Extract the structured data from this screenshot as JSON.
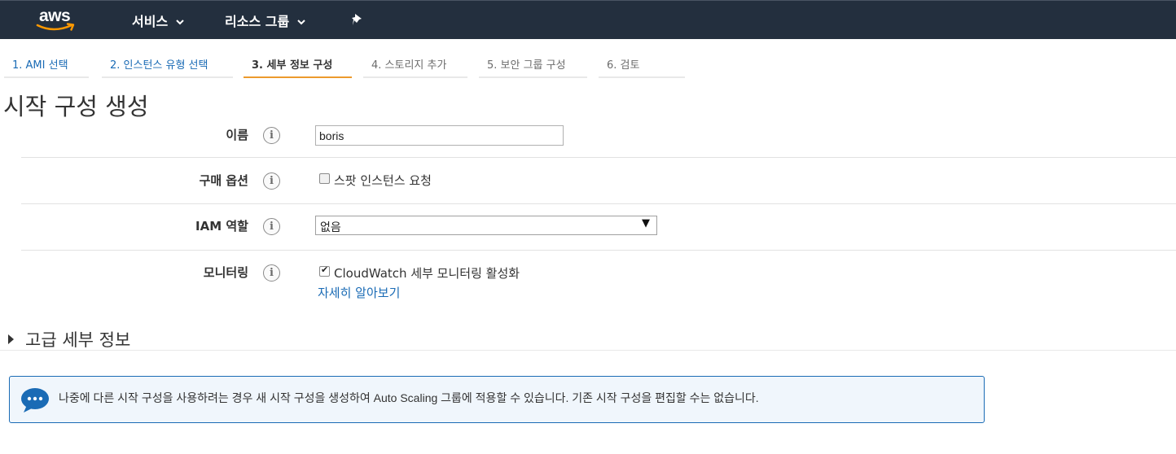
{
  "header": {
    "logo_text": "aws",
    "services_label": "서비스",
    "resource_groups_label": "리소스 그룹",
    "icons": {
      "services_chevron": "chevron-down-icon",
      "resource_groups_chevron": "chevron-down-icon",
      "pin": "pin-icon"
    }
  },
  "wizard": {
    "steps": [
      {
        "label": "1. AMI 선택",
        "state": "link"
      },
      {
        "label": "2. 인스턴스 유형 선택",
        "state": "link"
      },
      {
        "label": "3. 세부 정보 구성",
        "state": "active"
      },
      {
        "label": "4. 스토리지 추가",
        "state": "disabled"
      },
      {
        "label": "5. 보안 그룹 구성",
        "state": "disabled"
      },
      {
        "label": "6. 검토",
        "state": "disabled"
      }
    ]
  },
  "page": {
    "title": "시작 구성 생성"
  },
  "form": {
    "name": {
      "label": "이름",
      "value": "boris"
    },
    "purchase": {
      "label": "구매 옵션",
      "spot_label": "스팟 인스턴스 요청",
      "spot_checked": false
    },
    "iam": {
      "label": "IAM 역할",
      "selected": "없음"
    },
    "monitoring": {
      "label": "모니터링",
      "cloudwatch_label": "CloudWatch 세부 모니터링 활성화",
      "cloudwatch_checked": true,
      "learn_more": "자세히 알아보기"
    },
    "info_glyph": "i"
  },
  "advanced": {
    "label": "고급 세부 정보"
  },
  "notice": {
    "text": "나중에 다른 시작 구성을 사용하려는 경우 새 시작 구성을 생성하여 Auto Scaling 그룹에 적용할 수 있습니다. 기존 시작 구성을 편집할 수는 없습니다.",
    "icon": "chat-bubble-icon"
  },
  "colors": {
    "nav_bg": "#232f3e",
    "link": "#1a6bb5",
    "active_tab": "#ec9a2c",
    "notice_border": "#1a6bb5",
    "notice_icon": "#1a6bb5"
  }
}
